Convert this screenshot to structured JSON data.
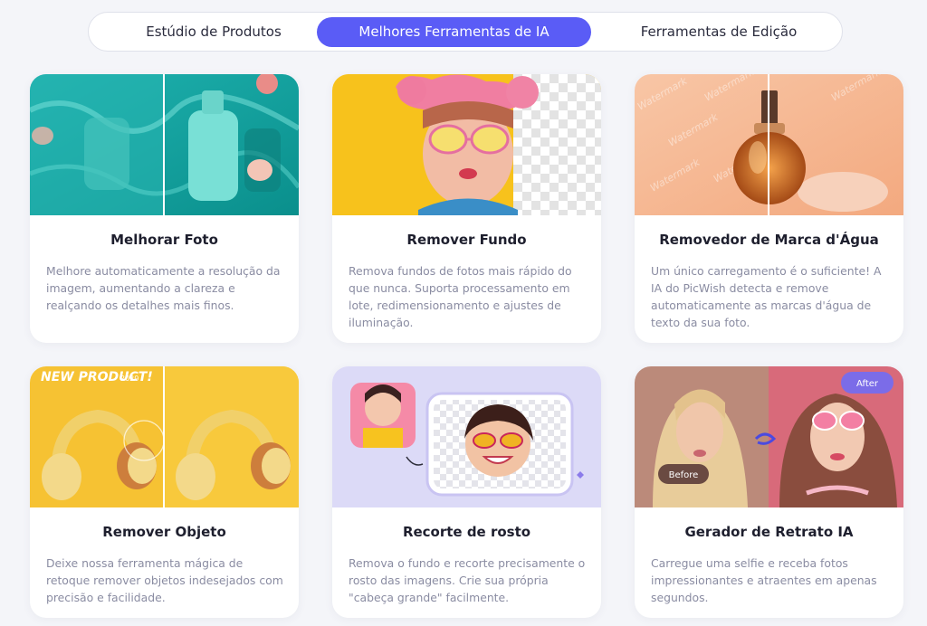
{
  "tabs": [
    {
      "label": "Estúdio de Produtos",
      "active": false
    },
    {
      "label": "Melhores Ferramentas de IA",
      "active": true
    },
    {
      "label": "Ferramentas de Edição",
      "active": false
    }
  ],
  "colors": {
    "accent": "#5a5cf6",
    "title": "#1e1f2e",
    "desc": "#8a8ca2",
    "background": "#f4f5f9"
  },
  "cards": [
    {
      "title": "Melhorar Foto",
      "description": "Melhore automaticamente a resolução da imagem, aumentando a clareza e realçando os detalhes mais finos.",
      "image": "teal-product-bottles-before-after"
    },
    {
      "title": "Remover Fundo",
      "description": "Remova fundos de fotos mais rápido do que nunca. Suporta processamento em lote, redimensionamento e ajustes de iluminação.",
      "image": "woman-pink-hair-transparent-background"
    },
    {
      "title": "Removedor de Marca d'Água",
      "description": "Um único carregamento é o suficiente! A IA do PicWish detecta e remove automaticamente as marcas d'água de texto da sua foto.",
      "image": "perfume-bottle-watermark",
      "watermark_text": "Watermark"
    },
    {
      "title": "Remover Objeto",
      "description": "Deixe nossa ferramenta mágica de retoque remover objetos indesejados com precisão e facilidade.",
      "image": "yellow-headphones-ad",
      "overlay_text": "NEW PRODUCT!",
      "overlay_year": "2020"
    },
    {
      "title": "Recorte de rosto",
      "description": "Remova o fundo e recorte precisamente o rosto das imagens. Crie sua própria \"cabeça grande\" facilmente.",
      "image": "face-cutout-sticker"
    },
    {
      "title": "Gerador de Retrato IA",
      "description": "Carregue uma selfie e receba fotos impressionantes e atraentes em apenas segundos.",
      "image": "portrait-before-after",
      "before_label": "Before",
      "after_label": "After"
    }
  ]
}
